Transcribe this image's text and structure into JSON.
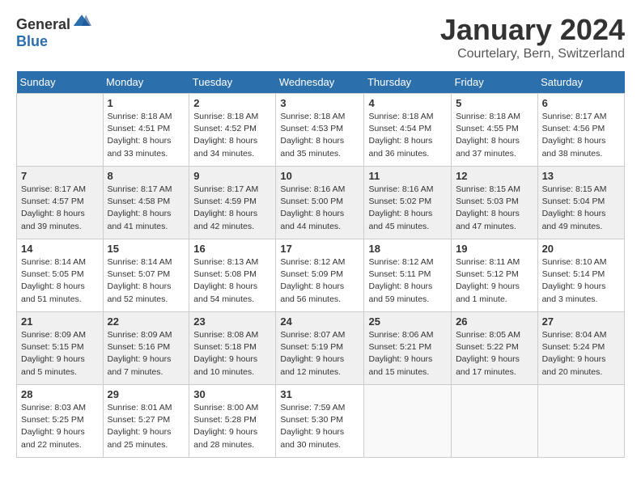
{
  "logo": {
    "general": "General",
    "blue": "Blue"
  },
  "title": "January 2024",
  "location": "Courtelary, Bern, Switzerland",
  "weekdays": [
    "Sunday",
    "Monday",
    "Tuesday",
    "Wednesday",
    "Thursday",
    "Friday",
    "Saturday"
  ],
  "weeks": [
    [
      {
        "day": "",
        "sunrise": "",
        "sunset": "",
        "daylight": ""
      },
      {
        "day": "1",
        "sunrise": "Sunrise: 8:18 AM",
        "sunset": "Sunset: 4:51 PM",
        "daylight": "Daylight: 8 hours and 33 minutes."
      },
      {
        "day": "2",
        "sunrise": "Sunrise: 8:18 AM",
        "sunset": "Sunset: 4:52 PM",
        "daylight": "Daylight: 8 hours and 34 minutes."
      },
      {
        "day": "3",
        "sunrise": "Sunrise: 8:18 AM",
        "sunset": "Sunset: 4:53 PM",
        "daylight": "Daylight: 8 hours and 35 minutes."
      },
      {
        "day": "4",
        "sunrise": "Sunrise: 8:18 AM",
        "sunset": "Sunset: 4:54 PM",
        "daylight": "Daylight: 8 hours and 36 minutes."
      },
      {
        "day": "5",
        "sunrise": "Sunrise: 8:18 AM",
        "sunset": "Sunset: 4:55 PM",
        "daylight": "Daylight: 8 hours and 37 minutes."
      },
      {
        "day": "6",
        "sunrise": "Sunrise: 8:17 AM",
        "sunset": "Sunset: 4:56 PM",
        "daylight": "Daylight: 8 hours and 38 minutes."
      }
    ],
    [
      {
        "day": "7",
        "sunrise": "Sunrise: 8:17 AM",
        "sunset": "Sunset: 4:57 PM",
        "daylight": "Daylight: 8 hours and 39 minutes."
      },
      {
        "day": "8",
        "sunrise": "Sunrise: 8:17 AM",
        "sunset": "Sunset: 4:58 PM",
        "daylight": "Daylight: 8 hours and 41 minutes."
      },
      {
        "day": "9",
        "sunrise": "Sunrise: 8:17 AM",
        "sunset": "Sunset: 4:59 PM",
        "daylight": "Daylight: 8 hours and 42 minutes."
      },
      {
        "day": "10",
        "sunrise": "Sunrise: 8:16 AM",
        "sunset": "Sunset: 5:00 PM",
        "daylight": "Daylight: 8 hours and 44 minutes."
      },
      {
        "day": "11",
        "sunrise": "Sunrise: 8:16 AM",
        "sunset": "Sunset: 5:02 PM",
        "daylight": "Daylight: 8 hours and 45 minutes."
      },
      {
        "day": "12",
        "sunrise": "Sunrise: 8:15 AM",
        "sunset": "Sunset: 5:03 PM",
        "daylight": "Daylight: 8 hours and 47 minutes."
      },
      {
        "day": "13",
        "sunrise": "Sunrise: 8:15 AM",
        "sunset": "Sunset: 5:04 PM",
        "daylight": "Daylight: 8 hours and 49 minutes."
      }
    ],
    [
      {
        "day": "14",
        "sunrise": "Sunrise: 8:14 AM",
        "sunset": "Sunset: 5:05 PM",
        "daylight": "Daylight: 8 hours and 51 minutes."
      },
      {
        "day": "15",
        "sunrise": "Sunrise: 8:14 AM",
        "sunset": "Sunset: 5:07 PM",
        "daylight": "Daylight: 8 hours and 52 minutes."
      },
      {
        "day": "16",
        "sunrise": "Sunrise: 8:13 AM",
        "sunset": "Sunset: 5:08 PM",
        "daylight": "Daylight: 8 hours and 54 minutes."
      },
      {
        "day": "17",
        "sunrise": "Sunrise: 8:12 AM",
        "sunset": "Sunset: 5:09 PM",
        "daylight": "Daylight: 8 hours and 56 minutes."
      },
      {
        "day": "18",
        "sunrise": "Sunrise: 8:12 AM",
        "sunset": "Sunset: 5:11 PM",
        "daylight": "Daylight: 8 hours and 59 minutes."
      },
      {
        "day": "19",
        "sunrise": "Sunrise: 8:11 AM",
        "sunset": "Sunset: 5:12 PM",
        "daylight": "Daylight: 9 hours and 1 minute."
      },
      {
        "day": "20",
        "sunrise": "Sunrise: 8:10 AM",
        "sunset": "Sunset: 5:14 PM",
        "daylight": "Daylight: 9 hours and 3 minutes."
      }
    ],
    [
      {
        "day": "21",
        "sunrise": "Sunrise: 8:09 AM",
        "sunset": "Sunset: 5:15 PM",
        "daylight": "Daylight: 9 hours and 5 minutes."
      },
      {
        "day": "22",
        "sunrise": "Sunrise: 8:09 AM",
        "sunset": "Sunset: 5:16 PM",
        "daylight": "Daylight: 9 hours and 7 minutes."
      },
      {
        "day": "23",
        "sunrise": "Sunrise: 8:08 AM",
        "sunset": "Sunset: 5:18 PM",
        "daylight": "Daylight: 9 hours and 10 minutes."
      },
      {
        "day": "24",
        "sunrise": "Sunrise: 8:07 AM",
        "sunset": "Sunset: 5:19 PM",
        "daylight": "Daylight: 9 hours and 12 minutes."
      },
      {
        "day": "25",
        "sunrise": "Sunrise: 8:06 AM",
        "sunset": "Sunset: 5:21 PM",
        "daylight": "Daylight: 9 hours and 15 minutes."
      },
      {
        "day": "26",
        "sunrise": "Sunrise: 8:05 AM",
        "sunset": "Sunset: 5:22 PM",
        "daylight": "Daylight: 9 hours and 17 minutes."
      },
      {
        "day": "27",
        "sunrise": "Sunrise: 8:04 AM",
        "sunset": "Sunset: 5:24 PM",
        "daylight": "Daylight: 9 hours and 20 minutes."
      }
    ],
    [
      {
        "day": "28",
        "sunrise": "Sunrise: 8:03 AM",
        "sunset": "Sunset: 5:25 PM",
        "daylight": "Daylight: 9 hours and 22 minutes."
      },
      {
        "day": "29",
        "sunrise": "Sunrise: 8:01 AM",
        "sunset": "Sunset: 5:27 PM",
        "daylight": "Daylight: 9 hours and 25 minutes."
      },
      {
        "day": "30",
        "sunrise": "Sunrise: 8:00 AM",
        "sunset": "Sunset: 5:28 PM",
        "daylight": "Daylight: 9 hours and 28 minutes."
      },
      {
        "day": "31",
        "sunrise": "Sunrise: 7:59 AM",
        "sunset": "Sunset: 5:30 PM",
        "daylight": "Daylight: 9 hours and 30 minutes."
      },
      {
        "day": "",
        "sunrise": "",
        "sunset": "",
        "daylight": ""
      },
      {
        "day": "",
        "sunrise": "",
        "sunset": "",
        "daylight": ""
      },
      {
        "day": "",
        "sunrise": "",
        "sunset": "",
        "daylight": ""
      }
    ]
  ]
}
